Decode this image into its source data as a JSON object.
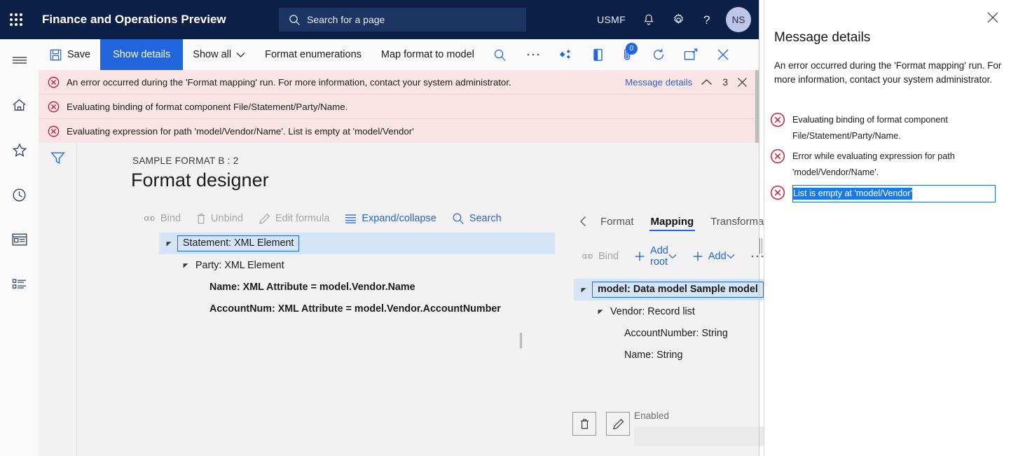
{
  "navbar": {
    "waffle_icon": "app-launcher-icon",
    "brand": "Finance and Operations Preview",
    "search": {
      "icon": "search-icon",
      "placeholder": "Search for a page",
      "value": ""
    },
    "company": "USMF",
    "notifications_icon": "bell-icon",
    "settings_icon": "gear-icon",
    "help_icon": "question-mark-icon",
    "avatar_initials": "NS"
  },
  "rail": {
    "items": [
      {
        "name": "hamburger-icon",
        "label": "Expand the navigation pane"
      },
      {
        "name": "home-icon",
        "label": "Home"
      },
      {
        "name": "star-icon",
        "label": "Favorites"
      },
      {
        "name": "clock-icon",
        "label": "Recent"
      },
      {
        "name": "workspaces-icon",
        "label": "Workspaces"
      },
      {
        "name": "modules-icon",
        "label": "Modules"
      }
    ]
  },
  "commandbar": {
    "save_label": "Save",
    "save_icon": "floppy-disk-icon",
    "show_details_label": "Show details",
    "show_all_label": "Show all",
    "format_enumerations_label": "Format enumerations",
    "map_format_to_model_label": "Map format to model",
    "search_icon": "search-icon",
    "overflow_icon": "ellipsis-icon",
    "related_icon": "related-information-icon",
    "office_icon": "open-in-office-icon",
    "attachments_icon": "attachment-icon",
    "attachments_count": "0",
    "refresh_icon": "refresh-icon",
    "popout_icon": "open-in-new-window-icon",
    "close_icon": "close-icon"
  },
  "messagebar": {
    "rows": [
      {
        "icon": "error-icon",
        "text": "An error occurred during the 'Format mapping' run. For more information, contact your system administrator."
      },
      {
        "icon": "error-icon",
        "text": "Evaluating binding of format component File/Statement/Party/Name."
      },
      {
        "icon": "error-icon",
        "text": "Evaluating expression for path 'model/Vendor/Name'.   List is empty at 'model/Vendor'"
      }
    ],
    "details_link": "Message details",
    "collapse_icon": "chevron-up-icon",
    "count": "3",
    "close_icon": "close-icon"
  },
  "page": {
    "filter_icon": "filter-icon",
    "breadcrumb": "SAMPLE FORMAT B : 2",
    "title": "Format designer",
    "toolbar": [
      {
        "label": "Bind",
        "icon": "link-icon",
        "state": "disabled"
      },
      {
        "label": "Unbind",
        "icon": "trash-icon",
        "state": "disabled"
      },
      {
        "label": "Edit formula",
        "icon": "pencil-icon",
        "state": "disabled"
      },
      {
        "label": "Expand/collapse",
        "icon": "list-icon",
        "state": "enabled"
      },
      {
        "label": "Search",
        "icon": "search-icon",
        "state": "enabled"
      }
    ],
    "format_tree": [
      {
        "label": "Statement: XML Element",
        "indent": 0,
        "expander": "expanded",
        "selected": true,
        "bold": false
      },
      {
        "label": "Party: XML Element",
        "indent": 1,
        "expander": "expanded",
        "selected": false,
        "bold": false
      },
      {
        "label": "Name: XML Attribute = model.Vendor.Name",
        "indent": 2,
        "expander": "none",
        "selected": false,
        "bold": true
      },
      {
        "label": "AccountNum: XML Attribute = model.Vendor.AccountNumber",
        "indent": 2,
        "expander": "none",
        "selected": false,
        "bold": true
      }
    ]
  },
  "rightpane": {
    "prev_icon": "chevron-left-icon",
    "next_icon": "chevron-right-icon",
    "tabs": [
      {
        "label": "Format",
        "active": false
      },
      {
        "label": "Mapping",
        "active": true
      },
      {
        "label": "Transformations",
        "active": false
      }
    ],
    "tools": [
      {
        "label": "Bind",
        "icon": "link-icon",
        "state": "disabled",
        "caret": false
      },
      {
        "label": "Add root",
        "icon": "plus-icon",
        "state": "enabled",
        "caret": true
      },
      {
        "label": "Add",
        "icon": "plus-icon",
        "state": "enabled",
        "caret": true
      },
      {
        "label": "",
        "icon": "ellipsis-icon",
        "state": "enabled",
        "caret": false
      }
    ],
    "model_tree": [
      {
        "label": "model: Data model Sample model",
        "indent": 0,
        "expander": "expanded",
        "selected": true,
        "bold": true
      },
      {
        "label": "Vendor: Record list",
        "indent": 1,
        "expander": "expanded",
        "selected": false,
        "bold": false
      },
      {
        "label": "AccountNumber: String",
        "indent": 2,
        "expander": "none",
        "selected": false,
        "bold": false
      },
      {
        "label": "Name: String",
        "indent": 2,
        "expander": "none",
        "selected": false,
        "bold": false
      }
    ],
    "delete_icon": "trash-icon",
    "edit_icon": "pencil-icon",
    "enabled_label": "Enabled",
    "enabled_value": ""
  },
  "flyout": {
    "close_icon": "close-icon",
    "title": "Message details",
    "intro": "An error occurred during the 'Format mapping' run. For more information, contact your system administrator.",
    "items": [
      {
        "icon": "error-icon",
        "text": "Evaluating binding of format component File/Statement/Party/Name.",
        "focused": false
      },
      {
        "icon": "error-icon",
        "text": "Error while evaluating expression for path 'model/Vendor/Name'.",
        "focused": false
      },
      {
        "icon": "error-icon",
        "text": "List is empty at 'model/Vendor'",
        "focused": true
      }
    ]
  },
  "colors": {
    "nav_background": "#0b1f47",
    "accent": "#2266dd",
    "error_background": "#fbe4e6",
    "error_icon": "#c8102e",
    "selection_blue": "#1a7ae0",
    "tree_selection": "#d6e4f7",
    "workspace_background": "#f2f2f2"
  }
}
